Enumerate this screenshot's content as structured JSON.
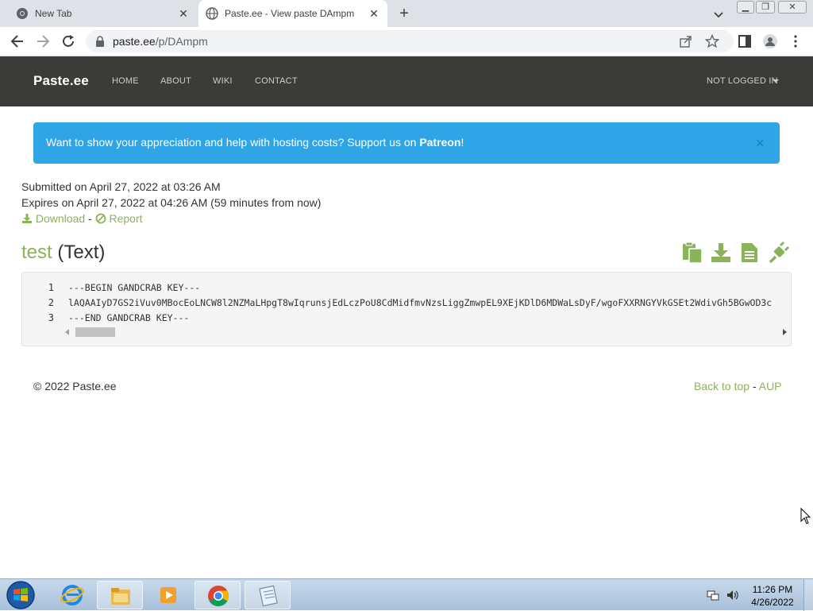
{
  "browser": {
    "tabs": [
      {
        "title": "New Tab",
        "icon": "chrome-icon"
      },
      {
        "title": "Paste.ee - View paste DAmpm",
        "icon": "globe-icon"
      }
    ],
    "address": {
      "host": "paste.ee",
      "path": "/p/DAmpm"
    }
  },
  "site": {
    "brand": "Paste.ee",
    "nav": {
      "home": "HOME",
      "about": "ABOUT",
      "wiki": "WIKI",
      "contact": "CONTACT",
      "login": "NOT LOGGED IN"
    }
  },
  "alert": {
    "text": "Want to show your appreciation and help with hosting costs? Support us on ",
    "link": "Patreon",
    "suffix": "!",
    "close": "×"
  },
  "paste": {
    "submitted": "Submitted on April 27, 2022 at 03:26 AM",
    "expires": "Expires on April 27, 2022 at 04:26 AM (59 minutes from now)",
    "download": "Download",
    "separator": "-",
    "report": "Report",
    "name": "test",
    "type": "(Text)",
    "lines": [
      {
        "num": "1",
        "text": "---BEGIN GANDCRAB KEY---"
      },
      {
        "num": "2",
        "text": "lAQAAIyD7GS2iVuv0MBocEoLNCW8l2NZMaLHpgT8wIqrunsjEdLczPoU8CdMidfmvNzsLiggZmwpEL9XEjKDlD6MDWaLsDyF/wgoFXXRNGYVkGSEt2WdivGh5BGwOD3c"
      },
      {
        "num": "3",
        "text": "---END GANDCRAB KEY---"
      }
    ],
    "actions": [
      "copy-icon",
      "download-icon",
      "raw-file-icon",
      "plug-icon"
    ]
  },
  "footer": {
    "copyright": "© 2022 Paste.ee",
    "back_to_top": "Back to top",
    "separator": "-",
    "aup": "AUP"
  },
  "taskbar": {
    "time": "11:26 PM",
    "date": "4/26/2022",
    "apps": [
      "internet-explorer-icon",
      "file-explorer-icon",
      "media-player-icon",
      "chrome-icon",
      "notepad-icon"
    ]
  },
  "colors": {
    "accent": "#8bb35a",
    "navbar": "#3b3b37",
    "alert": "#2fa4e7"
  }
}
